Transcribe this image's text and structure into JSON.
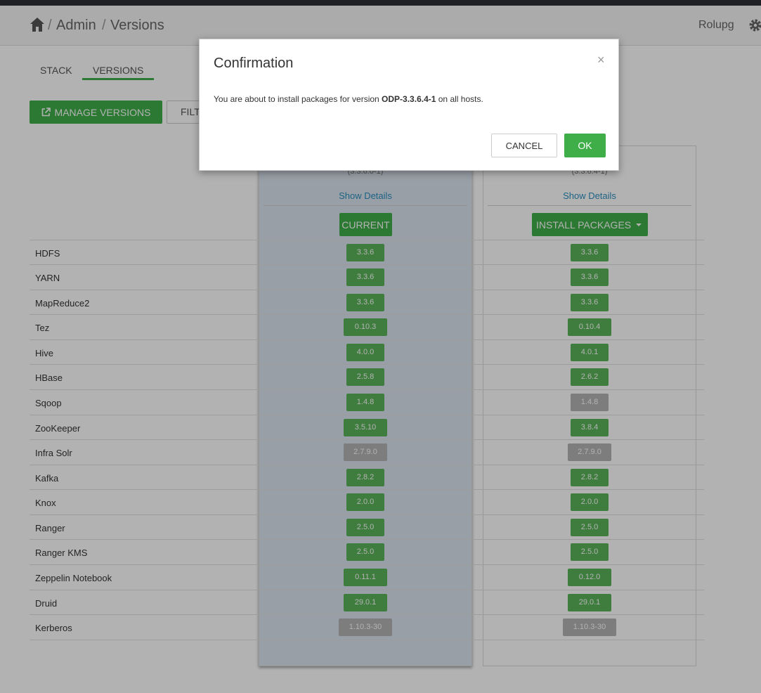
{
  "breadcrumb": {
    "level1": "Admin",
    "level2": "Versions"
  },
  "user": {
    "name": "Rolupg"
  },
  "tabs": [
    {
      "label": "STACK"
    },
    {
      "label": "VERSIONS"
    }
  ],
  "toolbar": {
    "manage_label": "MANAGE VERSIONS",
    "filter_label": "FILT"
  },
  "columns": {
    "current": {
      "version": "(3.3.6.0-1)",
      "show_details": "Show Details",
      "status_label": "CURRENT"
    },
    "target": {
      "version": "(3.3.6.4-1)",
      "show_details": "Show Details",
      "action_label": "INSTALL PACKAGES"
    }
  },
  "services": [
    {
      "name": "HDFS",
      "current": "3.3.6",
      "current_state": "green",
      "target": "3.3.6",
      "target_state": "green"
    },
    {
      "name": "YARN",
      "current": "3.3.6",
      "current_state": "green",
      "target": "3.3.6",
      "target_state": "green"
    },
    {
      "name": "MapReduce2",
      "current": "3.3.6",
      "current_state": "green",
      "target": "3.3.6",
      "target_state": "green"
    },
    {
      "name": "Tez",
      "current": "0.10.3",
      "current_state": "green",
      "target": "0.10.4",
      "target_state": "green"
    },
    {
      "name": "Hive",
      "current": "4.0.0",
      "current_state": "green",
      "target": "4.0.1",
      "target_state": "green"
    },
    {
      "name": "HBase",
      "current": "2.5.8",
      "current_state": "green",
      "target": "2.6.2",
      "target_state": "green"
    },
    {
      "name": "Sqoop",
      "current": "1.4.8",
      "current_state": "green",
      "target": "1.4.8",
      "target_state": "gray"
    },
    {
      "name": "ZooKeeper",
      "current": "3.5.10",
      "current_state": "green",
      "target": "3.8.4",
      "target_state": "green"
    },
    {
      "name": "Infra Solr",
      "current": "2.7.9.0",
      "current_state": "gray",
      "target": "2.7.9.0",
      "target_state": "gray"
    },
    {
      "name": "Kafka",
      "current": "2.8.2",
      "current_state": "green",
      "target": "2.8.2",
      "target_state": "green"
    },
    {
      "name": "Knox",
      "current": "2.0.0",
      "current_state": "green",
      "target": "2.0.0",
      "target_state": "green"
    },
    {
      "name": "Ranger",
      "current": "2.5.0",
      "current_state": "green",
      "target": "2.5.0",
      "target_state": "green"
    },
    {
      "name": "Ranger KMS",
      "current": "2.5.0",
      "current_state": "green",
      "target": "2.5.0",
      "target_state": "green"
    },
    {
      "name": "Zeppelin Notebook",
      "current": "0.11.1",
      "current_state": "green",
      "target": "0.12.0",
      "target_state": "green"
    },
    {
      "name": "Druid",
      "current": "29.0.1",
      "current_state": "green",
      "target": "29.0.1",
      "target_state": "green"
    },
    {
      "name": "Kerberos",
      "current": "1.10.3-30",
      "current_state": "gray",
      "target": "1.10.3-30",
      "target_state": "gray"
    }
  ],
  "modal": {
    "title": "Confirmation",
    "body_prefix": "You are about to install packages for version ",
    "version": "ODP-3.3.6.4-1",
    "body_suffix": " on all hosts.",
    "cancel_label": "CANCEL",
    "ok_label": "OK"
  },
  "colors": {
    "accent_green": "#3fae49",
    "badge_green": "#5ab45a",
    "badge_gray": "#b3b3b3",
    "link_blue": "#2a8fbd"
  }
}
